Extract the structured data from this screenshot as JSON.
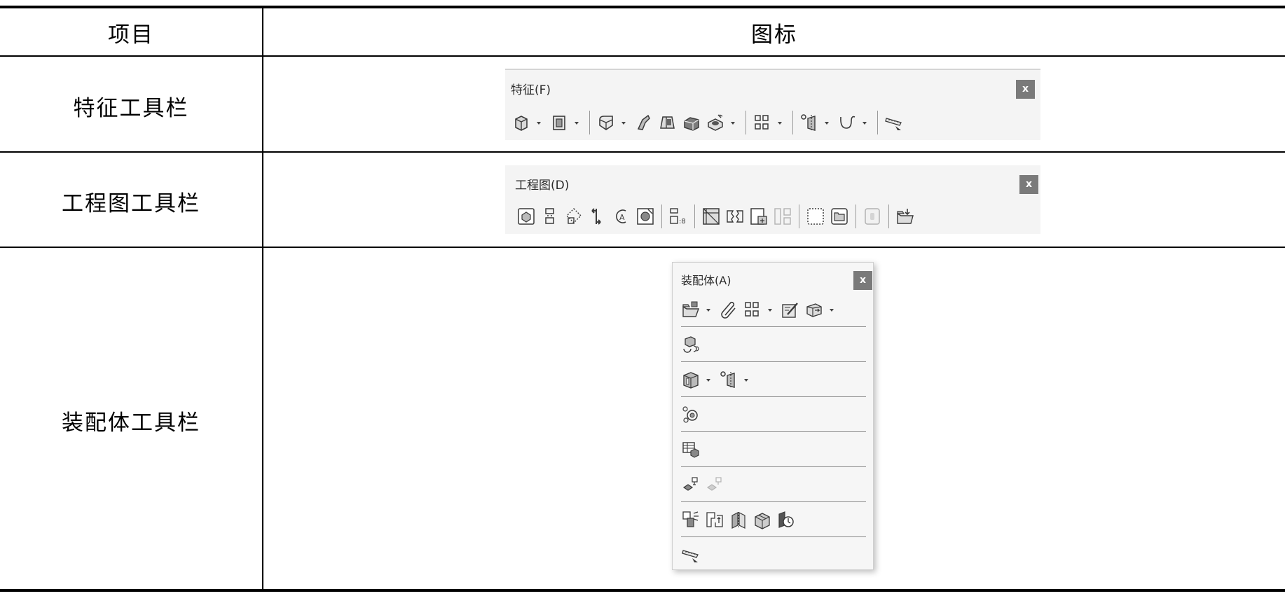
{
  "table": {
    "header": {
      "col1": "项目",
      "col2": "图标"
    },
    "rows": [
      {
        "item": "特征工具栏"
      },
      {
        "item": "工程图工具栏"
      },
      {
        "item": "装配体工具栏"
      }
    ]
  },
  "toolbars": {
    "features": {
      "title": "特征(F)",
      "close": "x"
    },
    "drawing": {
      "title": "工程图(D)",
      "close": "x"
    },
    "assembly": {
      "title": "装配体(A)",
      "close": "x"
    }
  },
  "icons": {
    "features": [
      "extruded-boss-icon",
      "extruded-cut-icon",
      "fillet-icon",
      "rib-icon",
      "draft-icon",
      "shell-icon",
      "hole-wizard-icon",
      "linear-pattern-icon",
      "reference-geometry-icon",
      "curves-icon",
      "instant3d-icon"
    ],
    "drawing": [
      "model-view-icon",
      "projected-view-icon",
      "auxiliary-view-icon",
      "section-view-icon",
      "detail-view-icon",
      "broken-out-section-icon",
      "alternate-position-view-icon",
      "crop-view-icon",
      "break-view-icon",
      "align-view-icon",
      "empty-view-icon",
      "sheet-icon",
      "layer-icon",
      "update-view-icon"
    ],
    "assembly": [
      "insert-components-icon",
      "mate-icon",
      "linear-component-pattern-icon",
      "smart-fasteners-icon",
      "move-component-icon",
      "show-hidden-components-icon",
      "assembly-features-icon",
      "reference-geometry-icon",
      "new-motion-study-icon",
      "bill-of-materials-icon",
      "exploded-view-icon",
      "explode-line-sketch-icon",
      "interference-detection-icon",
      "clearance-verification-icon",
      "hole-alignment-icon",
      "large-assembly-mode-icon",
      "performance-evaluation-icon",
      "instant3d-icon"
    ]
  },
  "colors": {
    "rule": "#000000",
    "toolbar_bg": "#f4f4f4",
    "close_bg": "#7a7a7a",
    "icon_stroke": "#3a3a3a"
  }
}
